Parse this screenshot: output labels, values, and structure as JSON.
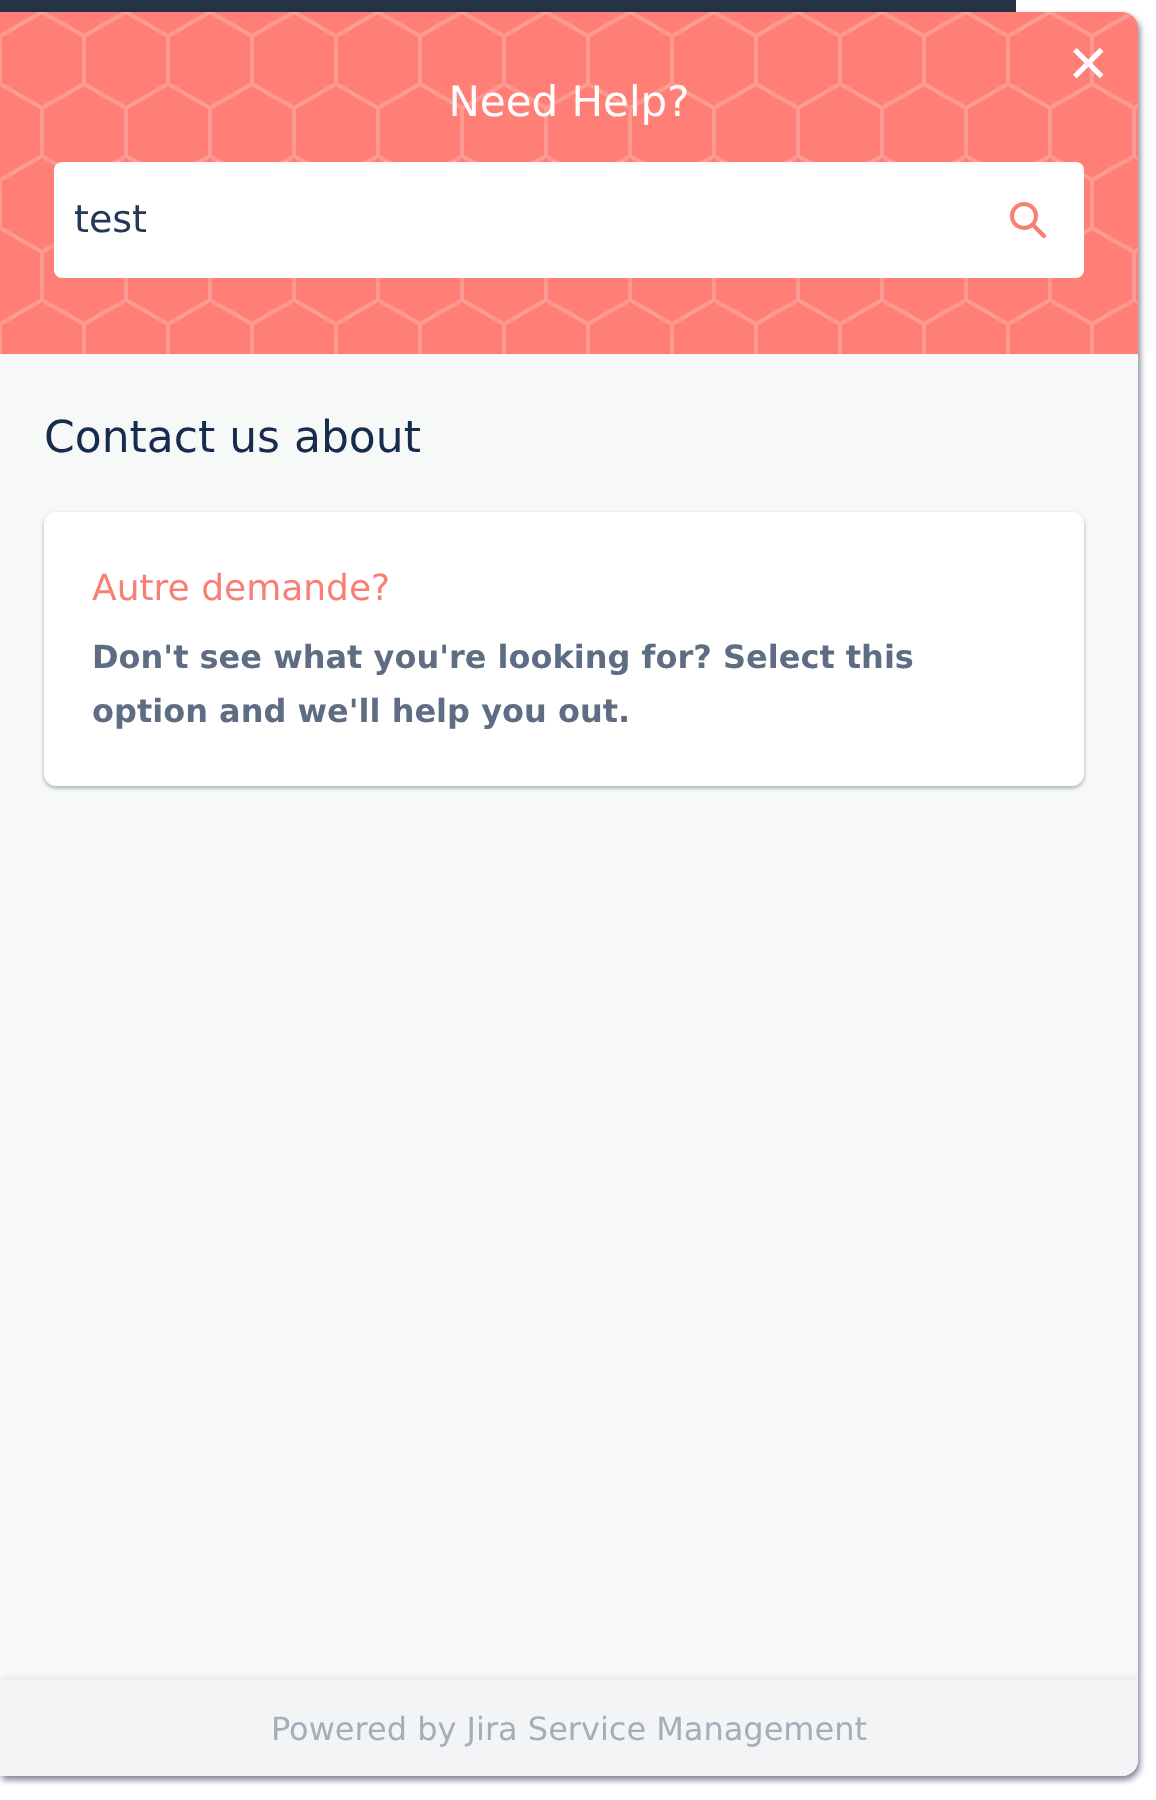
{
  "header": {
    "title": "Need Help?",
    "close": "✕",
    "search": {
      "value": "test"
    }
  },
  "section_title": "Contact us about",
  "options": [
    {
      "title": "Autre demande?",
      "description": "Don't see what you're looking for? Select this option and we'll help you out."
    }
  ],
  "footer": "Powered by Jira Service Management"
}
